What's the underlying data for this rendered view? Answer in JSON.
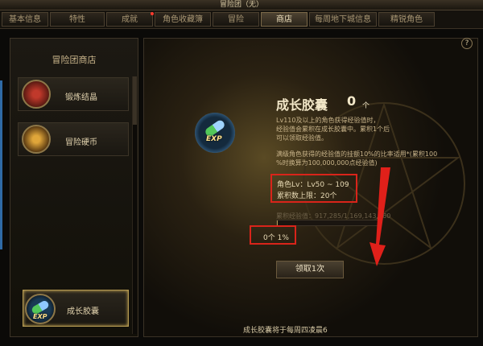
{
  "window": {
    "title": "冒险团（无）"
  },
  "tabs": [
    {
      "label": "基本信息",
      "active": false
    },
    {
      "label": "特性",
      "active": false
    },
    {
      "label": "成就",
      "active": false
    },
    {
      "label": "角色收藏簿",
      "active": false
    },
    {
      "label": "冒险",
      "active": false
    },
    {
      "label": "商店",
      "active": true
    },
    {
      "label": "每周地下城信息",
      "active": false
    },
    {
      "label": "精锐角色",
      "active": false
    }
  ],
  "help": {
    "label": "?"
  },
  "shop": {
    "title": "冒险团商店",
    "items": [
      {
        "label": "锻炼结晶",
        "icon": "crystal-icon"
      },
      {
        "label": "冒险硬币",
        "icon": "coin-chest-icon"
      },
      {
        "label": "成长胶囊",
        "icon": "exp-capsule-icon",
        "active": true
      }
    ]
  },
  "detail": {
    "title": "成长胶囊",
    "count": "0",
    "count_unit": "个",
    "desc_lines": [
      "Lv110及以上的角色获得经验值时，",
      "经验值会累积在成长胶囊中。累积1个后",
      "可以领取经验值。"
    ],
    "desc2_lines": [
      "满级角色获得的经验值的挂额10%的比率适用*(累积100",
      "%时换算为100,000,000点经验值)"
    ],
    "level_line": "角色Lv：Lv50 ~ 109",
    "limit_line": "累积数上限：20个",
    "exp_label": "累积经验值：917,285/1,169,143,960",
    "exp_progress": 0.01,
    "pct": "0个 1%",
    "claim_button": "领取1次",
    "badge": "EXP",
    "notice": "成长胶囊将于每周四凌晨6"
  },
  "colors": {
    "accent": "#b59a52",
    "highlight": "#d9241a"
  }
}
